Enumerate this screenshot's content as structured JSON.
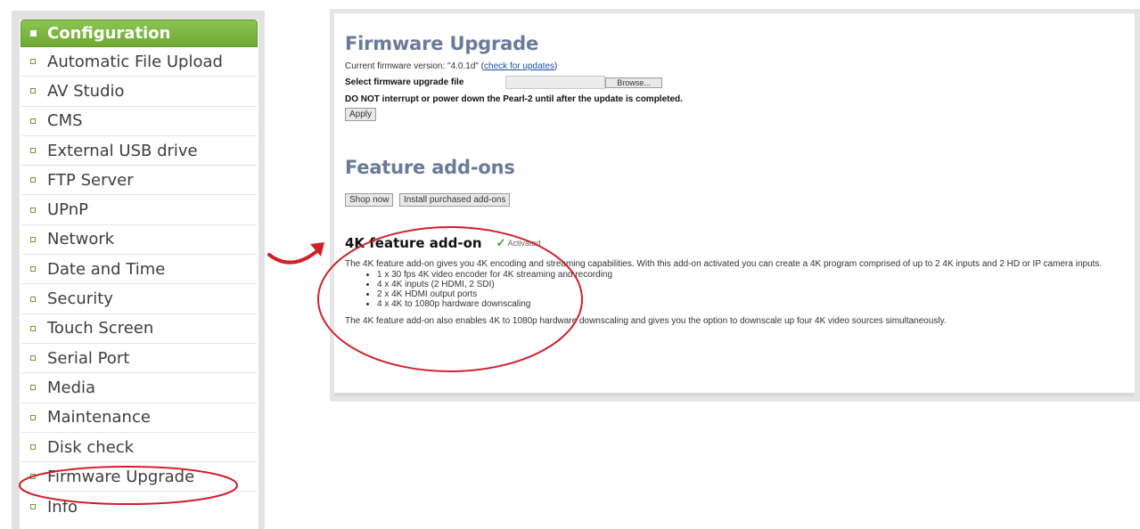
{
  "sidebar": {
    "header": "Configuration",
    "items": [
      {
        "label": "Automatic File Upload"
      },
      {
        "label": "AV Studio"
      },
      {
        "label": "CMS"
      },
      {
        "label": "External USB drive"
      },
      {
        "label": "FTP Server"
      },
      {
        "label": "UPnP"
      },
      {
        "label": "Network"
      },
      {
        "label": "Date and Time"
      },
      {
        "label": "Security"
      },
      {
        "label": "Touch Screen"
      },
      {
        "label": "Serial Port"
      },
      {
        "label": "Media"
      },
      {
        "label": "Maintenance"
      },
      {
        "label": "Disk check"
      },
      {
        "label": "Firmware Upgrade"
      },
      {
        "label": "Info"
      }
    ]
  },
  "firmware": {
    "title": "Firmware Upgrade",
    "current_prefix": "Current firmware version: \"4.0.1d\" (",
    "check_link": "check for updates",
    "current_suffix": ")",
    "select_label": "Select firmware upgrade file",
    "browse_label": "Browse...",
    "warning": "DO NOT interrupt or power down the Pearl-2 until after the update is completed.",
    "apply_label": "Apply"
  },
  "addons": {
    "title": "Feature add-ons",
    "shop_label": "Shop now",
    "install_label": "Install purchased add-ons",
    "feature_title": "4K feature add-on",
    "activated": "Activated",
    "description": "The 4K feature add-on gives you 4K encoding and streaming capabilities. With this add-on activated you can create a 4K program comprised of up to 2 4K inputs and 2 HD or IP camera inputs.",
    "bullets": [
      "1 x 30 fps 4K video encoder for 4K streaming and recording",
      "4 x 4K inputs (2 HDMI, 2 SDI)",
      "2 x 4K HDMI output ports",
      "4 x 4K to 1080p hardware downscaling"
    ],
    "footer": "The 4K feature add-on also enables 4K to 1080p hardware downscaling and gives you the option to downscale up four 4K video sources simultaneously."
  },
  "colors": {
    "accent_green": "#7cb342",
    "heading_blue": "#6a7a99",
    "annotation_red": "#d0202a"
  }
}
